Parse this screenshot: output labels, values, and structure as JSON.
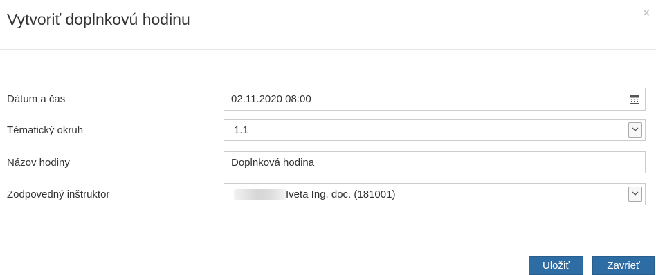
{
  "dialog": {
    "title": "Vytvoriť doplnkovú hodinu",
    "close_symbol": "×"
  },
  "form": {
    "datetime": {
      "label": "Dátum a čas",
      "value": "02.11.2020 08:00",
      "icon": "calendar-icon"
    },
    "topic": {
      "label": "Tématický okruh",
      "value": "1.1",
      "icon": "chevron-down-icon"
    },
    "name": {
      "label": "Názov hodiny",
      "value": "Doplnková hodina"
    },
    "instructor": {
      "label": "Zodpovedný inštruktor",
      "value": "Iveta Ing. doc. (181001)",
      "icon": "chevron-down-icon"
    }
  },
  "footer": {
    "save_label": "Uložiť",
    "close_label": "Zavrieť"
  },
  "colors": {
    "primary_button": "#2e6da4",
    "border": "#cccccc",
    "divider": "#e5e5e5"
  }
}
